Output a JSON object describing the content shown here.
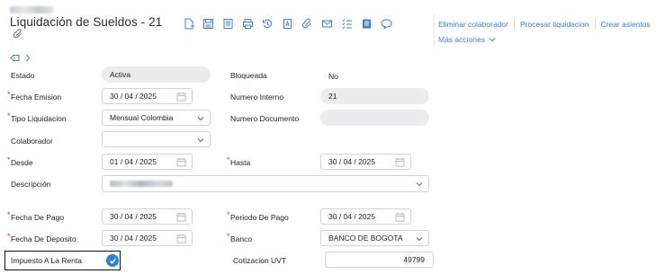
{
  "header": {
    "title": "Liquidación de Sueldos - 21",
    "actions": {
      "eliminar": "Eliminar colaborador",
      "procesar": "Procesar liquidacion",
      "crear": "Crear asientos",
      "mas": "Más acciones"
    },
    "toolbar_icons": [
      "new-document-icon",
      "save-icon",
      "documents-icon",
      "print-icon",
      "history-icon",
      "text-document-icon",
      "attach-icon",
      "email-icon",
      "checklist-icon",
      "notes-icon",
      "comment-icon"
    ]
  },
  "form": {
    "estado": {
      "label": "Estado",
      "value": "Activa"
    },
    "bloqueada": {
      "label": "Bloqueada",
      "value": "No"
    },
    "fecha_emision": {
      "label": "Fecha Emision",
      "value": "30 / 04 / 2025"
    },
    "numero_interno": {
      "label": "Numero Interno",
      "value": "21"
    },
    "tipo_liquidacion": {
      "label": "Tipo Liquidacion",
      "value": "Mensual Colombia"
    },
    "numero_documento": {
      "label": "Numero Documento",
      "value": ""
    },
    "colaborador": {
      "label": "Colaborador",
      "value": ""
    },
    "desde": {
      "label": "Desde",
      "value": "01 / 04 / 2025"
    },
    "hasta": {
      "label": "Hasta",
      "value": "30 / 04 / 2025"
    },
    "descripcion": {
      "label": "Descripción"
    },
    "fecha_pago": {
      "label": "Fecha De Pago",
      "value": "30 / 04 / 2025"
    },
    "periodo_pago": {
      "label": "Periodo De Pago",
      "value": "30 / 04 / 2025"
    },
    "fecha_deposito": {
      "label": "Fecha De Deposito",
      "value": "30 / 04 / 2025"
    },
    "banco": {
      "label": "Banco",
      "value": "BANCO DE BOGOTA"
    },
    "impuesto_renta": {
      "label": "Impuesto A La Renta",
      "checked": true
    },
    "cotizacion_uvt": {
      "label": "Cotizacion UVT",
      "value": "49799"
    }
  },
  "colors": {
    "accent": "#3b7fd4",
    "required": "#dd3333",
    "readonly_bg": "#ececef"
  }
}
